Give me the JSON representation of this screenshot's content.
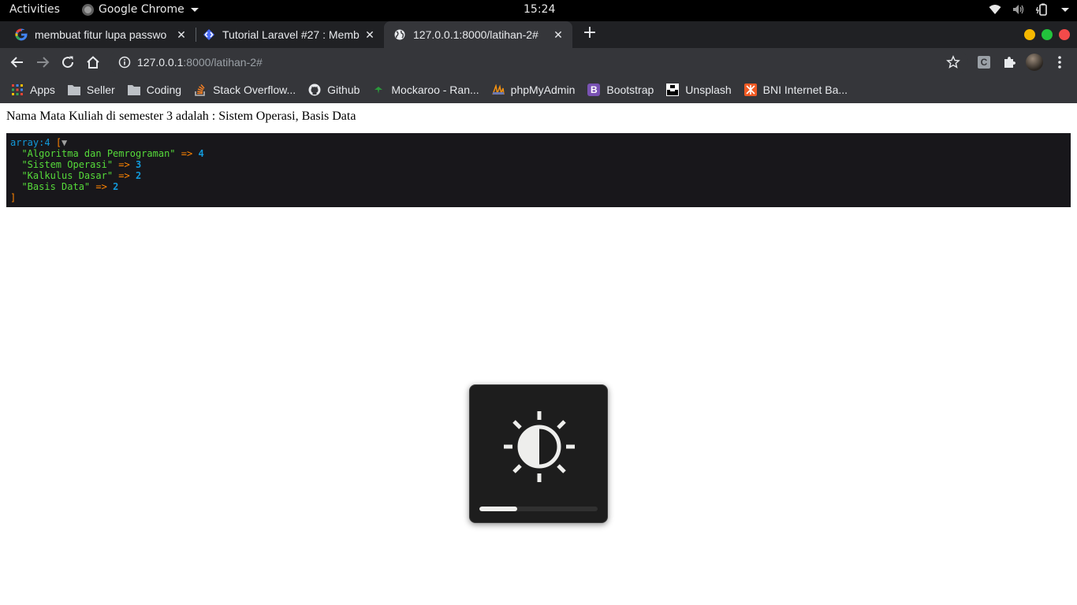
{
  "topbar": {
    "activities": "Activities",
    "app_name": "Google Chrome",
    "clock": "15:24"
  },
  "tabs": [
    {
      "title": "membuat fitur lupa passwo",
      "icon": "google-icon",
      "active": false
    },
    {
      "title": "Tutorial Laravel #27 : Memb",
      "icon": "diamond-code-icon",
      "active": false
    },
    {
      "title": "127.0.0.1:8000/latihan-2#",
      "icon": "globe-icon",
      "active": true
    }
  ],
  "window_controls": {
    "colors": [
      "#f5b800",
      "#22c33c",
      "#f24a4a"
    ]
  },
  "omnibox": {
    "host": "127.0.0.1",
    "rest": ":8000/latihan-2#"
  },
  "toolbar": {
    "extension_letter": "C"
  },
  "bookmarks": [
    {
      "label": "Apps",
      "icon": "apps-grid-icon"
    },
    {
      "label": "Seller",
      "icon": "folder-icon"
    },
    {
      "label": "Coding",
      "icon": "folder-icon"
    },
    {
      "label": "Stack Overflow...",
      "icon": "stackoverflow-icon"
    },
    {
      "label": "Github",
      "icon": "github-icon"
    },
    {
      "label": "Mockaroo - Ran...",
      "icon": "mockaroo-icon"
    },
    {
      "label": "phpMyAdmin",
      "icon": "phpmyadmin-icon"
    },
    {
      "label": "Bootstrap",
      "icon": "bootstrap-icon"
    },
    {
      "label": "Unsplash",
      "icon": "unsplash-icon"
    },
    {
      "label": "BNI Internet Ba...",
      "icon": "bni-icon"
    }
  ],
  "page": {
    "text": "Nama Mata Kuliah di semester 3 adalah : Sistem Operasi, Basis Data",
    "dump": {
      "header_type": "array:4",
      "open_bracket": "[",
      "toggle": "▼",
      "close_bracket": "]",
      "arrow": "=>",
      "entries": [
        {
          "key": "\"Algoritma dan Pemrograman\"",
          "value": "4"
        },
        {
          "key": "\"Sistem Operasi\"",
          "value": "3"
        },
        {
          "key": "\"Kalkulus Dasar\"",
          "value": "2"
        },
        {
          "key": "\"Basis Data\"",
          "value": "2"
        }
      ]
    }
  },
  "osd": {
    "icon": "brightness-icon",
    "level": 0.32
  }
}
